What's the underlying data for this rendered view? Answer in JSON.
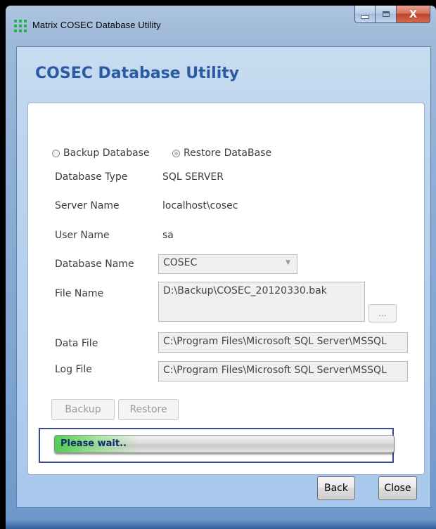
{
  "window": {
    "title": "Matrix COSEC Database Utility",
    "close_glyph": "X"
  },
  "heading": "COSEC Database Utility",
  "mode": {
    "options": [
      {
        "label": "Backup Database",
        "selected": false
      },
      {
        "label": "Restore DataBase",
        "selected": true
      }
    ]
  },
  "fields": {
    "database_type_label": "Database Type",
    "database_type_value": "SQL SERVER",
    "server_name_label": "Server Name",
    "server_name_value": "localhost\\cosec",
    "user_name_label": "User Name",
    "user_name_value": "sa",
    "database_name_label": "Database Name",
    "database_name_value": "COSEC",
    "file_name_label": "File Name",
    "file_name_value": "D:\\Backup\\COSEC_20120330.bak",
    "browse_label": "...",
    "data_file_label": "Data File",
    "data_file_value": "C:\\Program Files\\Microsoft SQL Server\\MSSQL",
    "log_file_label": "Log File",
    "log_file_value": "C:\\Program Files\\Microsoft SQL Server\\MSSQL"
  },
  "actions": {
    "backup_label": "Backup",
    "restore_label": "Restore"
  },
  "progress": {
    "text": "Please wait..",
    "accent": "#3cc83c"
  },
  "footer": {
    "back_label": "Back",
    "close_label": "Close"
  },
  "icons": {
    "app": "app-dots-icon",
    "minimize": "minimize-icon",
    "maximize": "maximize-icon",
    "close": "close-icon",
    "dropdown": "chevron-down-icon"
  }
}
